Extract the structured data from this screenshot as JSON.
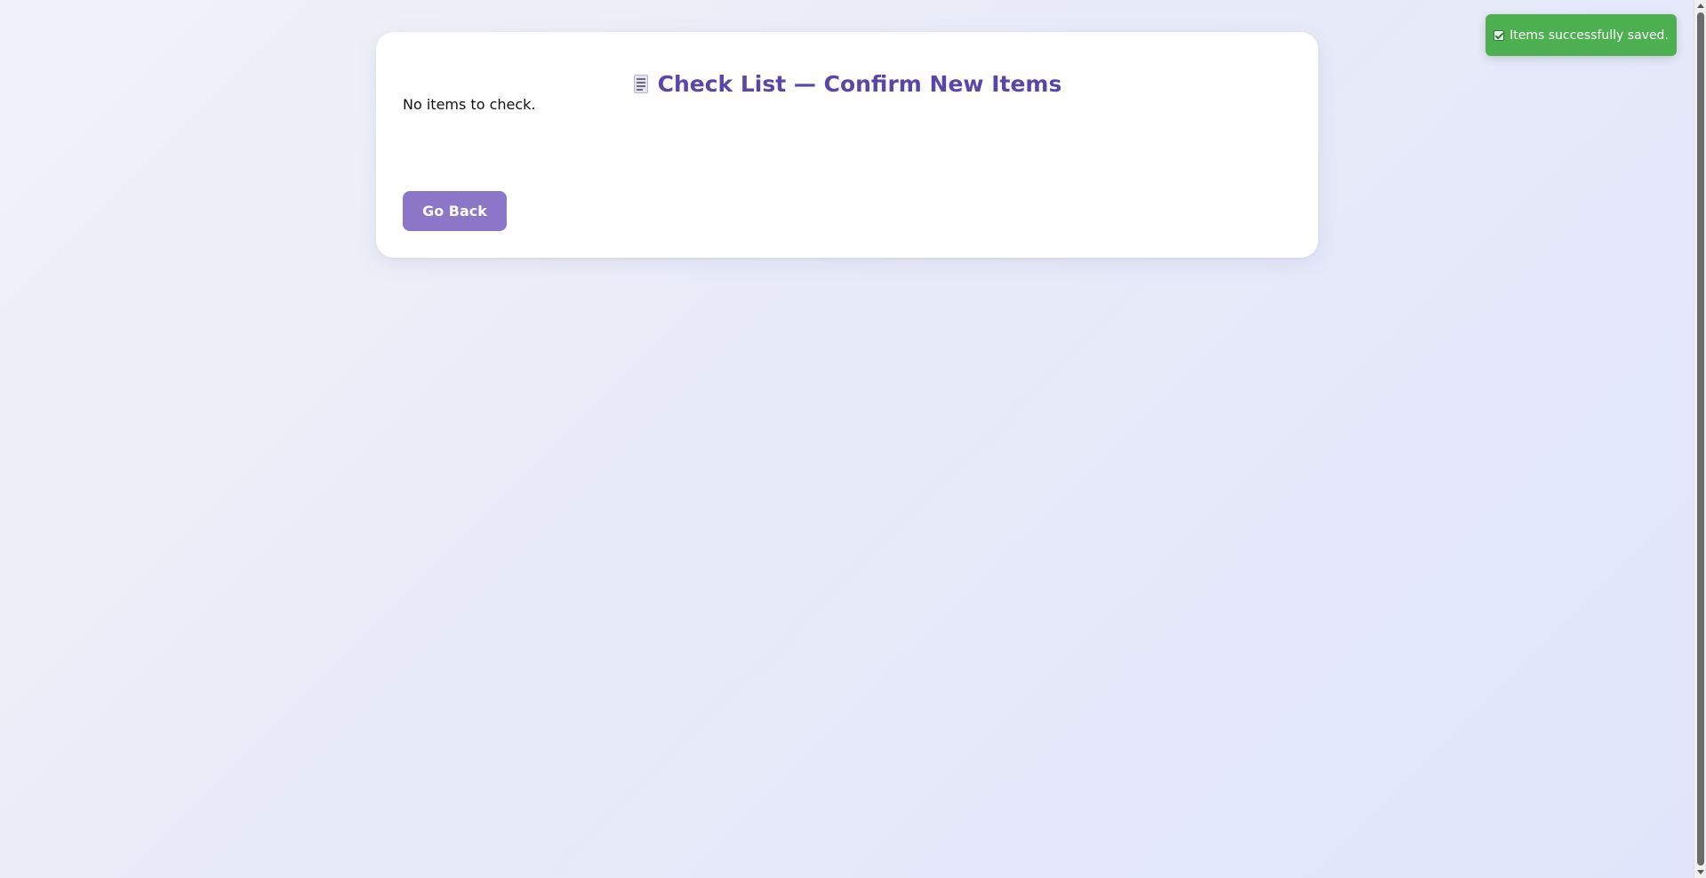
{
  "card": {
    "title_icon": "receipt-icon",
    "title": "Check List — Confirm New Items",
    "empty_message": "No items to check.",
    "back_button_label": "Go Back"
  },
  "toast": {
    "icon": "check-box-icon",
    "message": "Items successfully saved."
  },
  "colors": {
    "title": "#5a46a6",
    "button": "#8b76c8",
    "toast": "#4caf50"
  }
}
